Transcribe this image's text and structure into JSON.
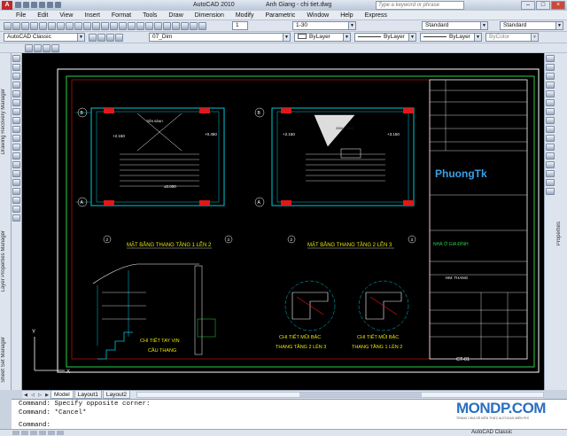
{
  "app": {
    "name": "AutoCAD 2010",
    "document": "Anh Giang - chi tiet.dwg",
    "logo_letter": "A",
    "help_placeholder": "Type a keyword or phrase"
  },
  "menu": [
    "File",
    "Edit",
    "View",
    "Insert",
    "Format",
    "Tools",
    "Draw",
    "Dimension",
    "Modify",
    "Parametric",
    "Window",
    "Help",
    "Express"
  ],
  "toolbar": {
    "workspace": "AutoCAD Classic",
    "layer": "07_Dim",
    "color": "ByLayer",
    "linetype": "ByLayer",
    "lineweight": "ByLayer",
    "plotstyle": "ByColor",
    "text_scale": "1",
    "dim_scale": "1-30",
    "text_style": "Standard",
    "dim_style": "Standard"
  },
  "palettes": {
    "left": [
      "Drawing Recovery Manager",
      "Layer Properties Manager",
      "Sheet Set Manager"
    ],
    "right": [
      "Properties"
    ]
  },
  "drawing": {
    "plan1_title": "MẶT BẰNG THANG TẦNG 1 LÊN 2",
    "plan2_title": "MẶT BẰNG THANG TẦNG 2 LÊN 3",
    "detail_rail_title": [
      "CHI TIẾT TAY VỊN",
      "CẦU THANG"
    ],
    "detail_step2_title": [
      "CHI TIẾT MŨI BẬC",
      "THANG TẦNG 2 LÊN 3"
    ],
    "detail_step1_title": [
      "CHI TIẾT MŨI BẬC",
      "THANG TẦNG 1 LÊN 2"
    ],
    "logo": "PhuongTk",
    "sheet_code": "CT-01",
    "dims": [
      "+2.150",
      "+0.450",
      "±0.000",
      "+2.150",
      "+3.150",
      "TIỀN SẢNH",
      "SẢNH TẦNG"
    ],
    "grid_labels": [
      "B",
      "A",
      "2",
      "3",
      "B",
      "A",
      "2",
      "3"
    ],
    "titleblock": [
      "NHÀ Ở GIA ĐÌNH",
      "HM: THANG",
      "CT-01"
    ]
  },
  "tabs": [
    "Model",
    "Layout1",
    "Layout2"
  ],
  "active_tab": "Model",
  "command_history": [
    "Command: Specify opposite corner:",
    "Command: *Cancel*"
  ],
  "command_prompt": "Command:",
  "watermark": {
    "main": "MONDP.COM",
    "sub": "TRANG CHIA SẺ KIẾN THỨC AUTOCAD MIỄN PHÍ"
  },
  "status": {
    "workspace": "AutoCAD Classic"
  },
  "colors": {
    "canvas": "#000000",
    "cad_line": "#00c8d8",
    "cad_accent": "#e01818",
    "cad_white": "#ffffff",
    "cad_green": "#2bd14a",
    "logo": "#3aa0e6"
  }
}
